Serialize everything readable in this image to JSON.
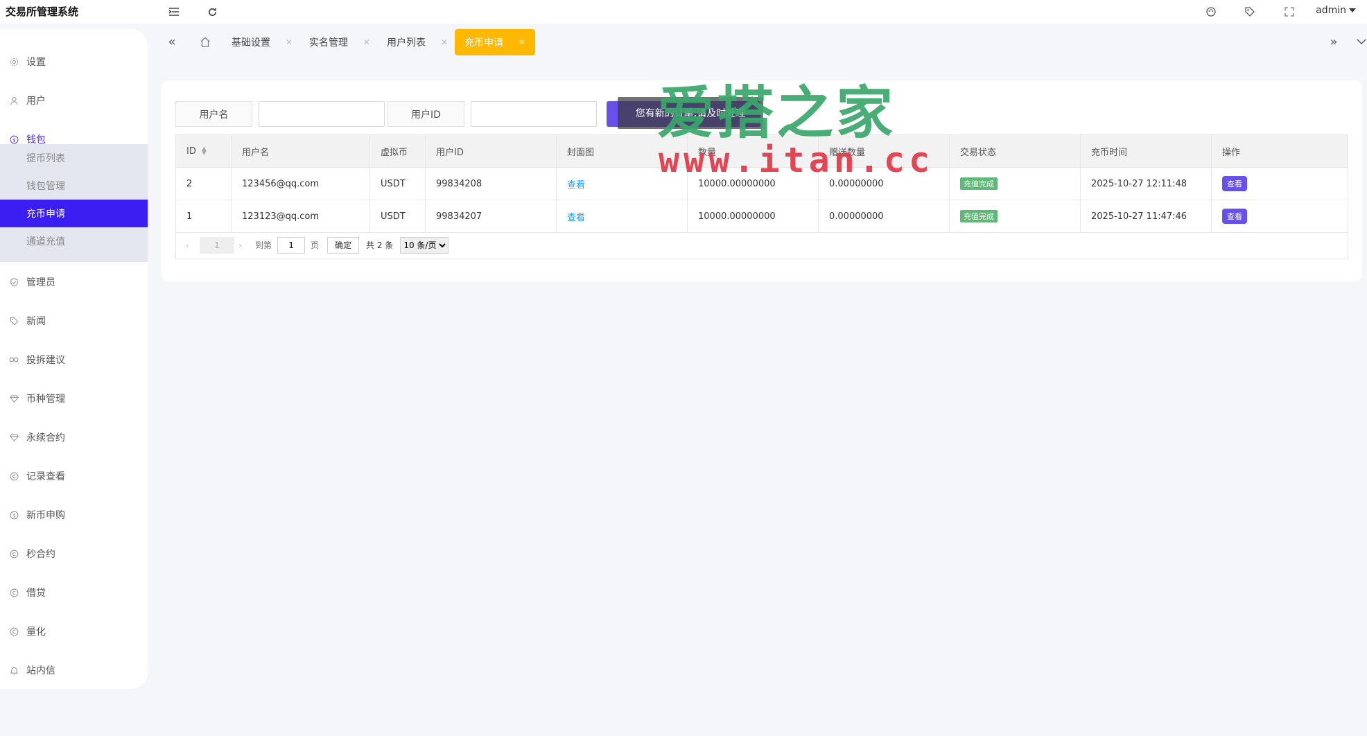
{
  "app": {
    "title": "交易所管理系统"
  },
  "header": {
    "user": "admin"
  },
  "sidebar": {
    "items": [
      {
        "label": "设置"
      },
      {
        "label": "用户"
      },
      {
        "label": "钱包"
      },
      {
        "label": "管理员"
      },
      {
        "label": "新闻"
      },
      {
        "label": "投拆建议"
      },
      {
        "label": "币种管理"
      },
      {
        "label": "永续合约"
      },
      {
        "label": "记录查看"
      },
      {
        "label": "新币申购"
      },
      {
        "label": "秒合约"
      },
      {
        "label": "借贷"
      },
      {
        "label": "量化"
      },
      {
        "label": "站内信"
      }
    ],
    "wallet_sub": [
      {
        "label": "提币列表"
      },
      {
        "label": "钱包管理"
      },
      {
        "label": "充币申请"
      },
      {
        "label": "通道充值"
      }
    ]
  },
  "tabs": [
    {
      "label": "基础设置"
    },
    {
      "label": "实名管理"
    },
    {
      "label": "用户列表"
    },
    {
      "label": "充币申请"
    }
  ],
  "filters": {
    "username_label": "用户名",
    "username_value": "",
    "userid_label": "用户ID",
    "userid_value": ""
  },
  "toast": "您有新的订单,请及时处理",
  "table": {
    "headers": [
      "ID",
      "用户名",
      "虚拟币",
      "用户ID",
      "封面图",
      "数量",
      "赠送数量",
      "交易状态",
      "充币时间",
      "操作"
    ],
    "rows": [
      {
        "id": "2",
        "username": "123456@qq.com",
        "coin": "USDT",
        "user_id": "99834208",
        "cover": "查看",
        "amount": "10000.00000000",
        "bonus": "0.00000000",
        "status": "充值完成",
        "time": "2025-10-27 12:11:48",
        "action": "查看"
      },
      {
        "id": "1",
        "username": "123123@qq.com",
        "coin": "USDT",
        "user_id": "99834207",
        "cover": "查看",
        "amount": "10000.00000000",
        "bonus": "0.00000000",
        "status": "充值完成",
        "time": "2025-10-27 11:47:46",
        "action": "查看"
      }
    ]
  },
  "pager": {
    "current": "1",
    "goto_label": "到第",
    "goto_value": "1",
    "page_unit": "页",
    "confirm": "确定",
    "total": "共 2 条",
    "size_option": "10 条/页"
  },
  "watermark": {
    "title": "爱搭之家",
    "url": "www.itan.cc"
  },
  "colors": {
    "accent": "#3b1ef2",
    "tab_active": "#ffb800",
    "button": "#6a50ea",
    "status_green": "#5fb878",
    "link": "#1e9fff"
  }
}
